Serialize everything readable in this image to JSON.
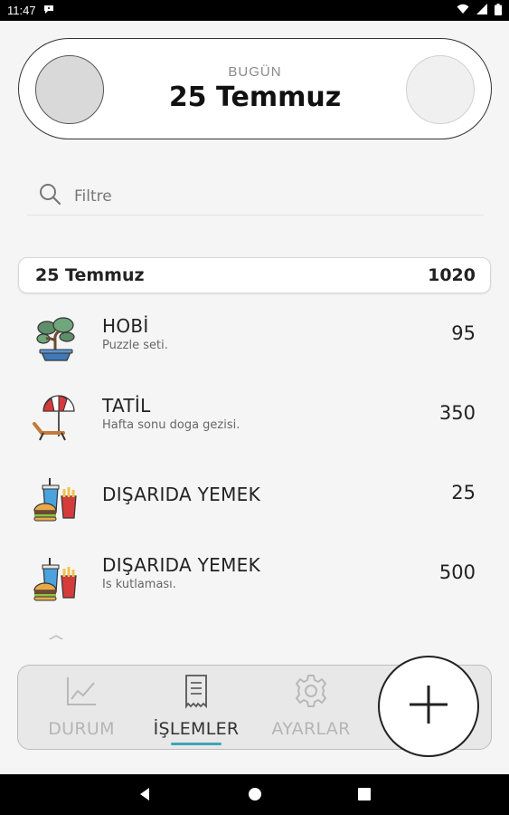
{
  "status_bar": {
    "time": "11:47"
  },
  "header": {
    "label": "BUGÜN",
    "date": "25 Temmuz"
  },
  "filter": {
    "placeholder": "Filtre"
  },
  "group": {
    "date": "25 Temmuz",
    "total": "1020"
  },
  "items": [
    {
      "title": "HOBİ",
      "subtitle": "Puzzle seti.",
      "amount": "95",
      "icon": "bonsai-icon"
    },
    {
      "title": "TATİL",
      "subtitle": "Hafta sonu doga gezisi.",
      "amount": "350",
      "icon": "beach-umbrella-icon"
    },
    {
      "title": "DIŞARIDA YEMEK",
      "subtitle": "",
      "amount": "25",
      "icon": "fast-food-icon"
    },
    {
      "title": "DIŞARIDA YEMEK",
      "subtitle": "Is kutlaması.",
      "amount": "500",
      "icon": "fast-food-icon"
    }
  ],
  "bottom_nav": {
    "tabs": [
      {
        "label": "DURUM",
        "icon": "chart-icon"
      },
      {
        "label": "İŞLEMLER",
        "icon": "receipt-icon"
      },
      {
        "label": "AYARLAR",
        "icon": "gear-icon"
      }
    ],
    "active": "İŞLEMLER",
    "accent": "#3ea5b7"
  }
}
